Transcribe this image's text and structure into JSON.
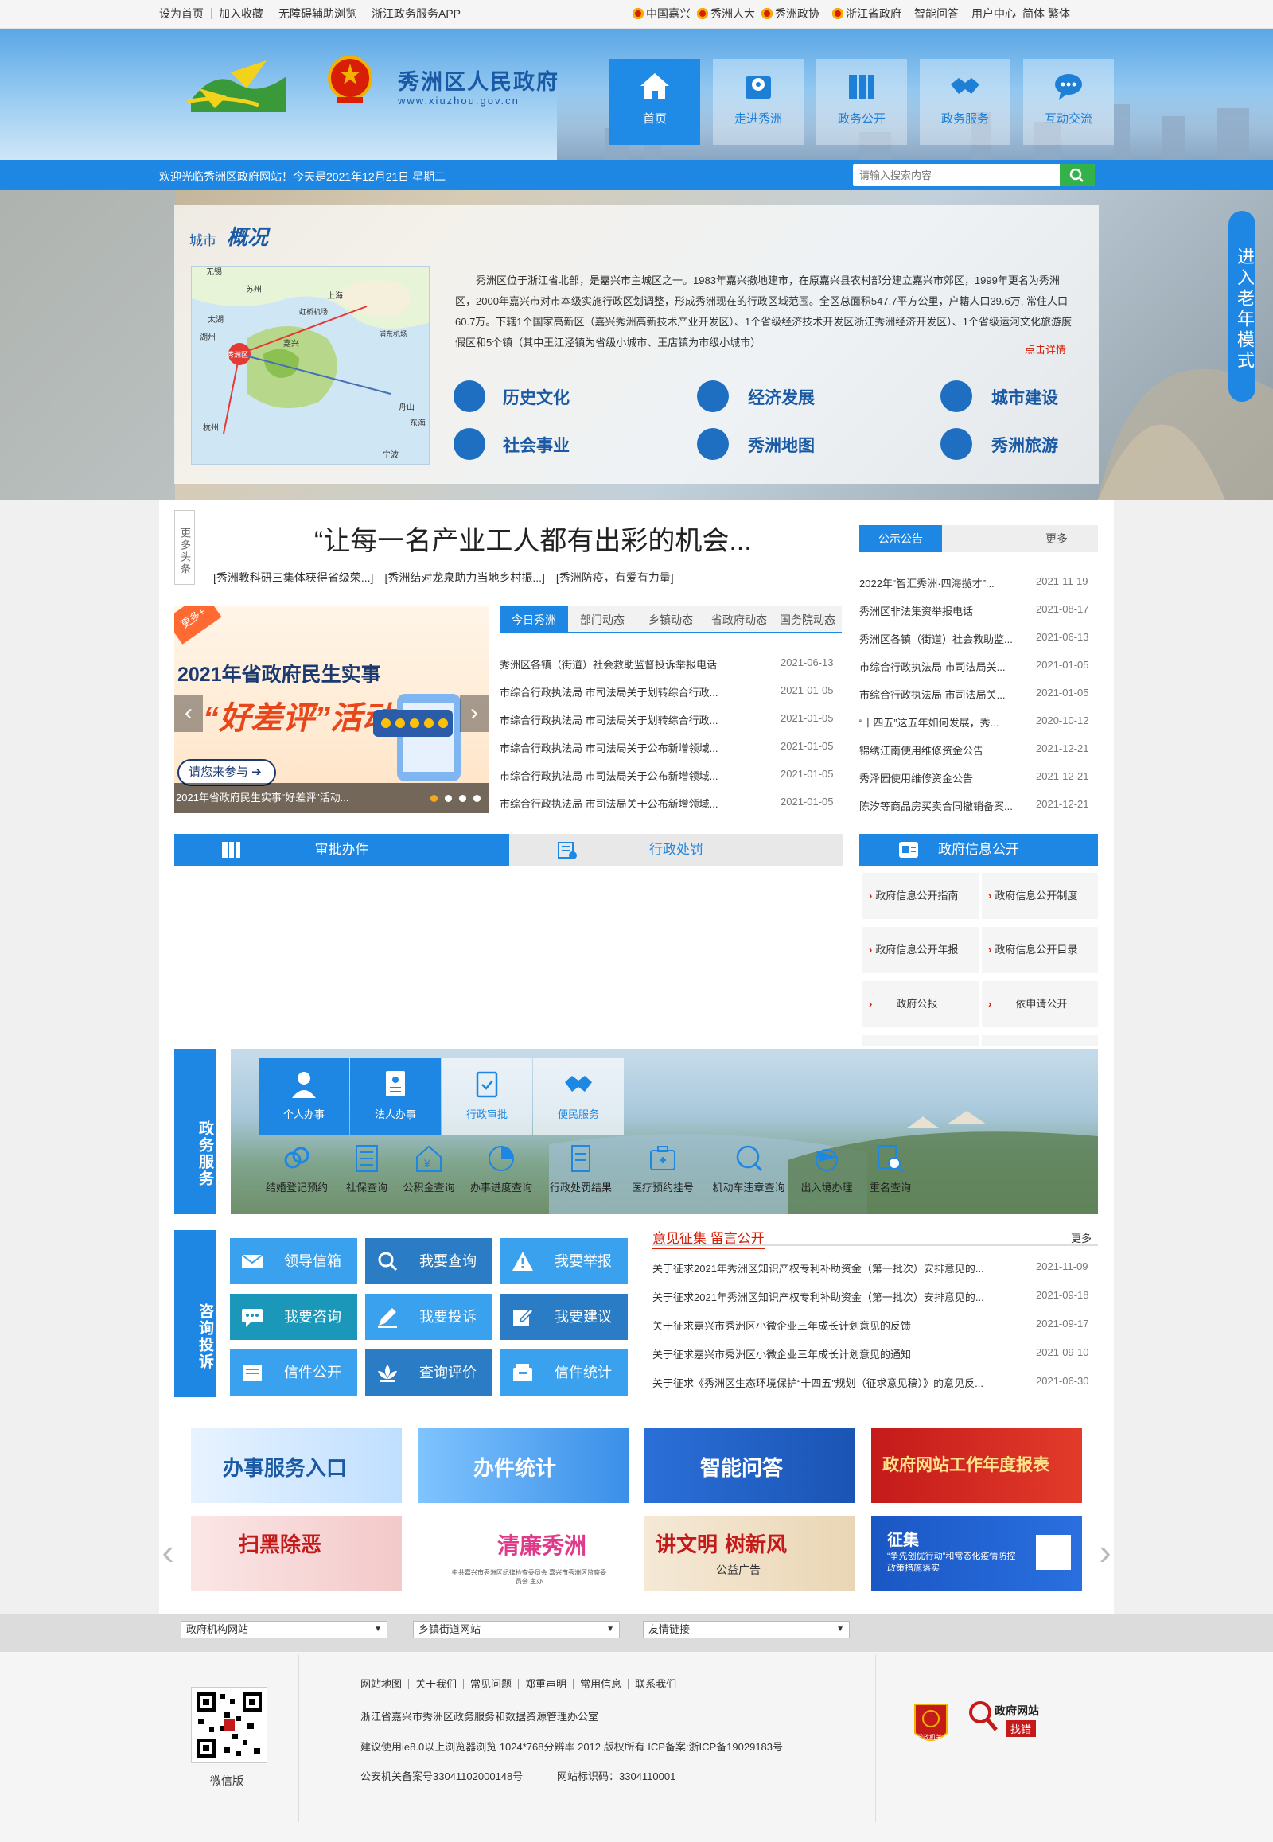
{
  "topbar": {
    "left_links": [
      "设为首页",
      "加入收藏",
      "无障碍辅助浏览",
      "浙江政务服务APP"
    ],
    "right_links": [
      "中国嘉兴",
      "秀洲人大",
      "秀洲政协",
      "浙江省政府",
      "智能问答",
      "用户中心",
      "简体",
      "繁体"
    ]
  },
  "header": {
    "site_title": "秀洲区人民政府",
    "site_url": "www.xiuzhou.gov.cn",
    "nav": [
      {
        "label": "首页",
        "icon": "home-icon"
      },
      {
        "label": "走进秀洲",
        "icon": "map-pin-icon"
      },
      {
        "label": "政务公开",
        "icon": "book-icon"
      },
      {
        "label": "政务服务",
        "icon": "handshake-icon"
      },
      {
        "label": "互动交流",
        "icon": "chat-icon"
      }
    ]
  },
  "welcome": {
    "text": "欢迎光临秀洲区政府网站！今天是2021年12月21日 星期二",
    "search_placeholder": "请输入搜索内容"
  },
  "overview": {
    "title_a": "城市",
    "title_b": "概况",
    "text": "秀洲区位于浙江省北部，是嘉兴市主城区之一。1983年嘉兴撤地建市，在原嘉兴县农村部分建立嘉兴市郊区，1999年更名为秀洲区，2000年嘉兴市对市本级实施行政区划调整，形成秀洲现在的行政区域范围。全区总面积547.7平方公里，户籍人口39.6万, 常住人口60.7万。下辖1个国家高新区（嘉兴秀洲高新技术产业开发区）、1个省级经济技术开发区浙江秀洲经济开发区）、1个省级运河文化旅游度假区和5个镇（其中王江泾镇为省级小城市、王店镇为市级小城市）",
    "more": "点击详情",
    "links": [
      "历史文化",
      "经济发展",
      "城市建设",
      "社会事业",
      "秀洲地图",
      "秀洲旅游"
    ],
    "map_labels": [
      "无锡",
      "苏州",
      "上海",
      "太湖",
      "湖州",
      "秀洲区",
      "嘉兴",
      "杭州",
      "宁波",
      "舟山",
      "东海",
      "虹桥机场",
      "浦东机场"
    ]
  },
  "elder_mode": "进入老年模式",
  "headlines": {
    "tag": "更多头条",
    "main": "“让每一名产业工人都有出彩的机会...",
    "sub": [
      "[秀洲教科研三集体获得省级荣...]",
      "[秀洲结对龙泉助力当地乡村振...]",
      "[秀洲防疫，有爱有力量]"
    ]
  },
  "notice": {
    "tabs": [
      "公示公告",
      "更多"
    ],
    "items": [
      {
        "title": "2022年“智汇秀洲·四海揽才”...",
        "date": "2021-11-19"
      },
      {
        "title": "秀洲区非法集资举报电话",
        "date": "2021-08-17"
      },
      {
        "title": "秀洲区各镇（街道）社会救助监...",
        "date": "2021-06-13"
      },
      {
        "title": "市综合行政执法局 市司法局关...",
        "date": "2021-01-05"
      },
      {
        "title": "市综合行政执法局 市司法局关...",
        "date": "2021-01-05"
      },
      {
        "title": "“十四五”这五年如何发展，秀...",
        "date": "2020-10-12"
      },
      {
        "title": "锦绣江南使用维修资金公告",
        "date": "2021-12-21"
      },
      {
        "title": "秀泽园使用维修资金公告",
        "date": "2021-12-21"
      },
      {
        "title": "陈汐等商品房买卖合同撤销备案...",
        "date": "2021-12-21"
      }
    ]
  },
  "slider": {
    "badge": "更多+",
    "line1": "2021年省政府民生实事",
    "line2": "“好差评”活动",
    "button": "请您来参与 ➔",
    "caption": "2021年省政府民生实事“好差评”活动..."
  },
  "news": {
    "tabs": [
      "今日秀洲",
      "部门动态",
      "乡镇动态",
      "省政府动态",
      "国务院动态"
    ],
    "items": [
      {
        "title": "秀洲区各镇（街道）社会救助监督投诉举报电话",
        "date": "2021-06-13"
      },
      {
        "title": "市综合行政执法局 市司法局关于划转综合行政...",
        "date": "2021-01-05"
      },
      {
        "title": "市综合行政执法局 市司法局关于划转综合行政...",
        "date": "2021-01-05"
      },
      {
        "title": "市综合行政执法局 市司法局关于公布新增领域...",
        "date": "2021-01-05"
      },
      {
        "title": "市综合行政执法局 市司法局关于公布新增领域...",
        "date": "2021-01-05"
      },
      {
        "title": "市综合行政执法局 市司法局关于公布新增领域...",
        "date": "2021-01-05"
      }
    ]
  },
  "approval": {
    "tab_on": "审批办件",
    "tab_off": "行政处罚"
  },
  "govinfo": {
    "title": "政府信息公开",
    "cells": [
      "政府信息公开指南",
      "政府信息公开制度",
      "政府信息公开年报",
      "政府信息公开目录",
      "政府公报",
      "依申请公开"
    ]
  },
  "services": {
    "label": "政务服务",
    "big": [
      {
        "label": "个人办事",
        "icon": "person-icon"
      },
      {
        "label": "法人办事",
        "icon": "id-card-icon"
      },
      {
        "label": "行政审批",
        "icon": "clipboard-check-icon"
      },
      {
        "label": "便民服务",
        "icon": "handshake-icon"
      }
    ],
    "small": [
      {
        "label": "结婚登记预约",
        "icon": "marriage-icon"
      },
      {
        "label": "社保查询",
        "icon": "list-icon"
      },
      {
        "label": "公积金查询",
        "icon": "house-yuan-icon"
      },
      {
        "label": "办事进度查询",
        "icon": "pie-icon"
      },
      {
        "label": "行政处罚结果",
        "icon": "document-icon"
      },
      {
        "label": "医疗预约挂号",
        "icon": "medical-kit-icon"
      },
      {
        "label": "机动车违章查询",
        "icon": "car-search-icon"
      },
      {
        "label": "出入境办理",
        "icon": "plane-globe-icon"
      },
      {
        "label": "重名查询",
        "icon": "name-search-icon"
      }
    ]
  },
  "consult": {
    "label": "咨询投诉",
    "buttons": [
      {
        "label": "领导信箱",
        "icon": "mail-icon"
      },
      {
        "label": "我要查询",
        "icon": "search-icon"
      },
      {
        "label": "我要举报",
        "icon": "warning-icon"
      },
      {
        "label": "我要咨询",
        "icon": "chat-icon"
      },
      {
        "label": "我要投诉",
        "icon": "pen-icon"
      },
      {
        "label": "我要建议",
        "icon": "edit-icon"
      },
      {
        "label": "信件公开",
        "icon": "letter-icon"
      },
      {
        "label": "查询评价",
        "icon": "lotus-icon"
      },
      {
        "label": "信件统计",
        "icon": "inbox-icon"
      }
    ]
  },
  "opinions": {
    "title": "意见征集  留言公开",
    "more": "更多",
    "items": [
      {
        "title": "关于征求2021年秀洲区知识产权专利补助资金（第一批次）安排意见的...",
        "date": "2021-11-09"
      },
      {
        "title": "关于征求2021年秀洲区知识产权专利补助资金（第一批次）安排意见的...",
        "date": "2021-09-18"
      },
      {
        "title": "关于征求嘉兴市秀洲区小微企业三年成长计划意见的反馈",
        "date": "2021-09-17"
      },
      {
        "title": "关于征求嘉兴市秀洲区小微企业三年成长计划意见的通知",
        "date": "2021-09-10"
      },
      {
        "title": "关于征求《秀洲区生态环境保护“十四五”规划（征求意见稿）》的意见反...",
        "date": "2021-06-30"
      }
    ]
  },
  "banners": {
    "row1": [
      "办事服务入口",
      "办件统计",
      "智能问答",
      "政府网站工作年度报表"
    ],
    "row2": [
      "扫黑除恶",
      "清廉秀洲",
      "讲文明 树新风",
      "征集"
    ],
    "row2_sub": [
      "",
      "中共嘉兴市秀洲区纪律检查委员会 嘉兴市秀洲区监察委员会 主办",
      "公益广告",
      "“争先创优行动”和常态化疫情防控政策措施落实"
    ]
  },
  "footer": {
    "selects": [
      "政府机构网站",
      "乡镇街道网站",
      "友情链接"
    ],
    "links": [
      "网站地图",
      "关于我们",
      "常见问题",
      "郑重声明",
      "常用信息",
      "联系我们"
    ],
    "org": "浙江省嘉兴市秀洲区政务服务和数据资源管理办公室",
    "browser": "建议使用ie8.0以上浏览器浏览 1024*768分辨率 2012 版权所有 ICP备案:浙ICP备19029183号",
    "police": "公安机关备案号33041102000148号",
    "site_id": "网站标识码：3304110001",
    "qr_caption": "微信版",
    "badge1": "党政机关",
    "badge2": "政府网站",
    "badge2b": "找错"
  }
}
